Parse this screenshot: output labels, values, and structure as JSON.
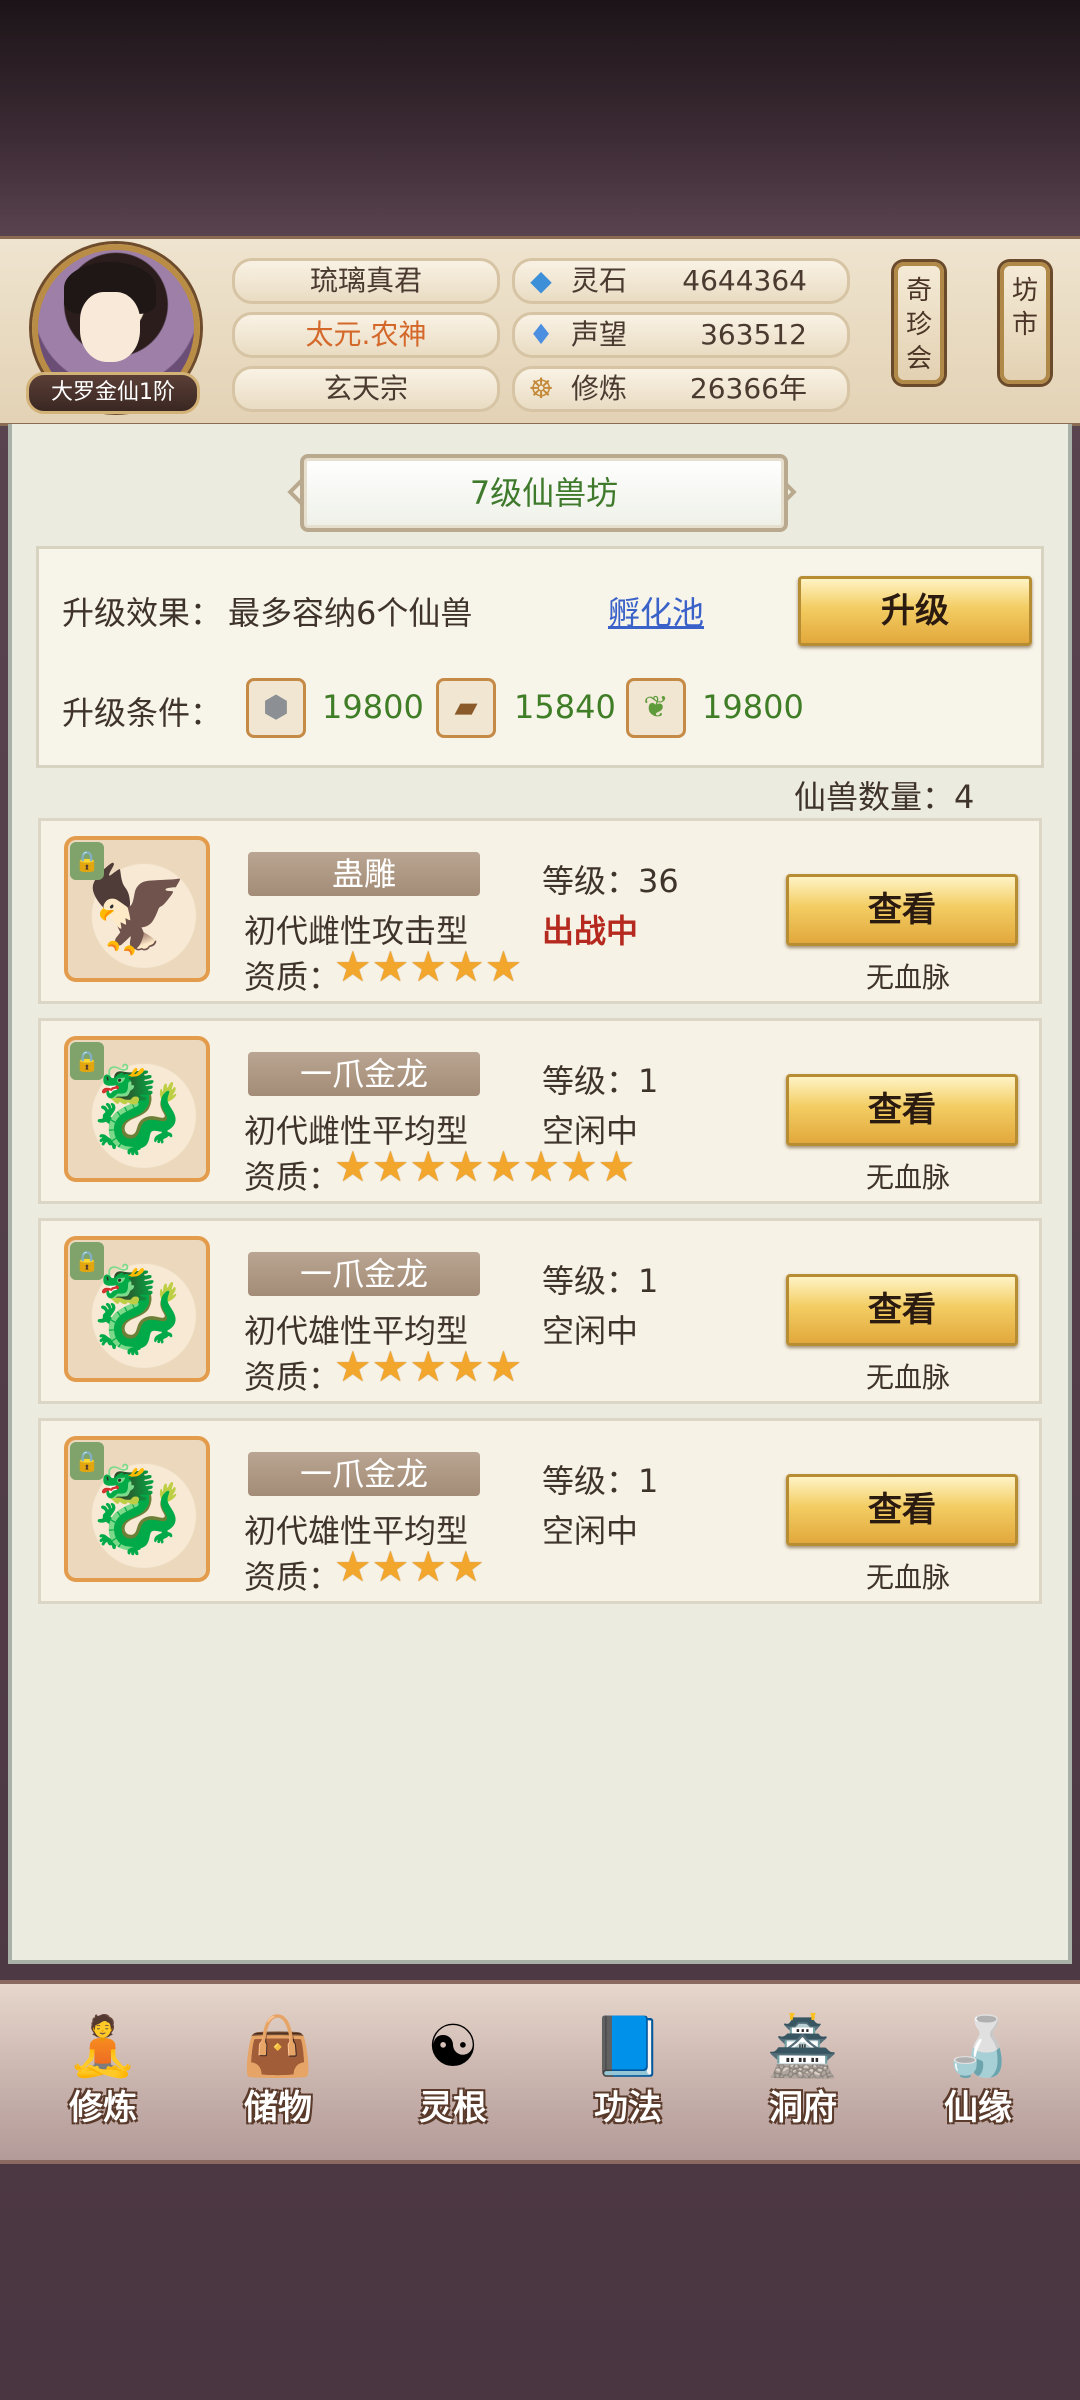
{
  "player": {
    "realm": "大罗金仙1阶",
    "name": "琉璃真君",
    "title": "太元.农神",
    "sect": "玄天宗"
  },
  "resources": [
    {
      "icon": "spirit-stone-icon",
      "label": "灵石",
      "value": "4644364"
    },
    {
      "icon": "reputation-icon",
      "label": "声望",
      "value": "363512"
    },
    {
      "icon": "cultivation-icon",
      "label": "修炼",
      "value": "26366年"
    }
  ],
  "side_buttons": {
    "treasure_fair": "奇珍会",
    "market": "坊市"
  },
  "building": {
    "title": "7级仙兽坊",
    "effect_label": "升级效果：",
    "effect_value": "最多容纳6个仙兽",
    "incubator_link": "孵化池",
    "upgrade_button": "升级",
    "condition_label": "升级条件：",
    "materials": [
      {
        "icon": "ore-icon",
        "amount": "19800"
      },
      {
        "icon": "wood-icon",
        "amount": "15840"
      },
      {
        "icon": "herb-icon",
        "amount": "19800"
      }
    ]
  },
  "beast_count_label": "仙兽数量：4",
  "beasts": [
    {
      "name": "蛊雕",
      "level": "等级：36",
      "type": "初代雌性攻击型",
      "status": "出战中",
      "status_color": "#b5291f",
      "aptitude_label": "资质：",
      "stars": 5,
      "view_button": "查看",
      "bloodline": "无血脉"
    },
    {
      "name": "一爪金龙",
      "level": "等级：1",
      "type": "初代雌性平均型",
      "status": "空闲中",
      "status_color": "#3f342c",
      "aptitude_label": "资质：",
      "stars": 8,
      "view_button": "查看",
      "bloodline": "无血脉"
    },
    {
      "name": "一爪金龙",
      "level": "等级：1",
      "type": "初代雄性平均型",
      "status": "空闲中",
      "status_color": "#3f342c",
      "aptitude_label": "资质：",
      "stars": 5,
      "view_button": "查看",
      "bloodline": "无血脉"
    },
    {
      "name": "一爪金龙",
      "level": "等级：1",
      "type": "初代雄性平均型",
      "status": "空闲中",
      "status_color": "#3f342c",
      "aptitude_label": "资质：",
      "stars": 4,
      "view_button": "查看",
      "bloodline": "无血脉"
    }
  ],
  "nav": [
    {
      "label": "修炼",
      "icon": "monk-icon"
    },
    {
      "label": "储物",
      "icon": "bag-icon"
    },
    {
      "label": "灵根",
      "icon": "spirit-root-icon"
    },
    {
      "label": "功法",
      "icon": "book-icon"
    },
    {
      "label": "洞府",
      "icon": "cave-dwelling-icon"
    },
    {
      "label": "仙缘",
      "icon": "gourd-icon"
    }
  ]
}
